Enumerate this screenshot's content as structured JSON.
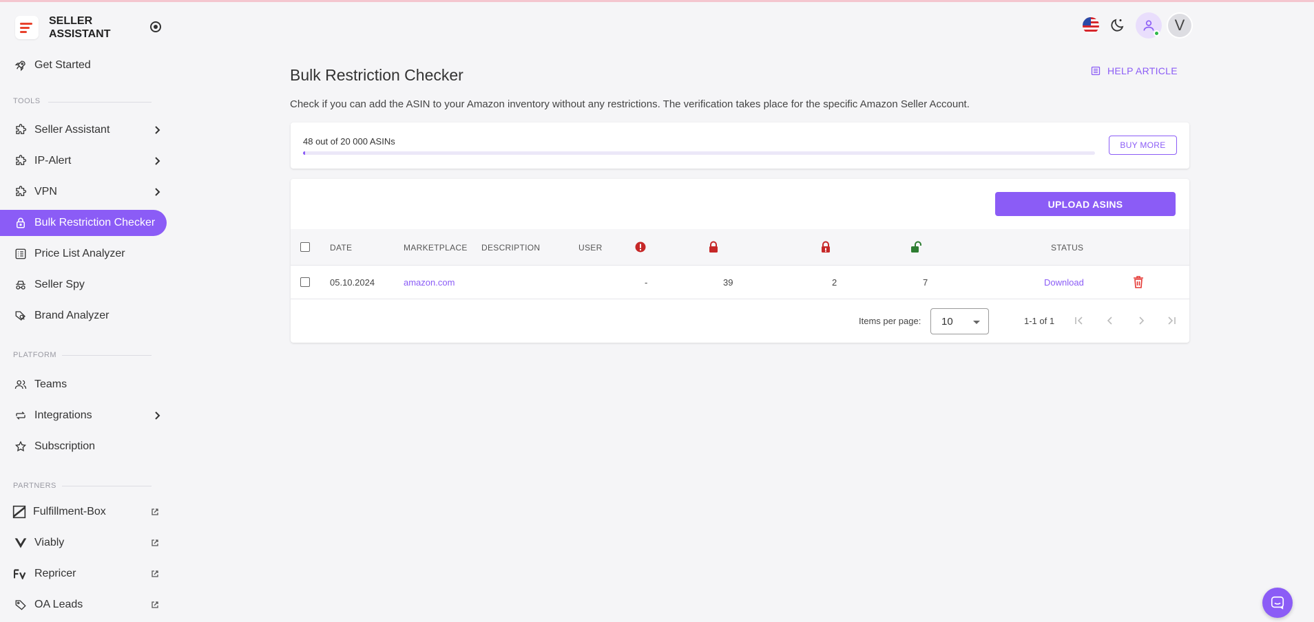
{
  "brand": {
    "name": "SELLER ASSISTANT"
  },
  "sidebar": {
    "get_started": "Get Started",
    "sections": {
      "tools": "TOOLS",
      "platform": "PLATFORM",
      "partners": "PARTNERS"
    },
    "tools": [
      {
        "label": "Seller Assistant",
        "icon": "puzzle-icon"
      },
      {
        "label": "IP-Alert",
        "icon": "puzzle-icon"
      },
      {
        "label": "VPN",
        "icon": "puzzle-icon"
      },
      {
        "label": "Bulk Restriction Checker",
        "icon": "lock-icon",
        "active": true
      },
      {
        "label": "Price List Analyzer",
        "icon": "list-icon"
      },
      {
        "label": "Seller Spy",
        "icon": "spy-icon"
      },
      {
        "label": "Brand Analyzer",
        "icon": "tag-search-icon"
      }
    ],
    "platform": [
      {
        "label": "Teams",
        "icon": "people-icon"
      },
      {
        "label": "Integrations",
        "icon": "swap-icon"
      },
      {
        "label": "Subscription",
        "icon": "star-icon"
      }
    ],
    "partners": [
      {
        "label": "Fulfillment-Box",
        "icon": "fulfillment-box-logo-icon"
      },
      {
        "label": "Viably",
        "icon": "viably-logo-icon"
      },
      {
        "label": "Repricer",
        "icon": "repricer-logo-icon"
      },
      {
        "label": "OA Leads",
        "icon": "tag-icon"
      }
    ]
  },
  "header": {
    "avatar_letter": "V"
  },
  "main": {
    "title": "Bulk Restriction Checker",
    "help_label": "HELP ARTICLE",
    "description": "Check if you can add the ASIN to your Amazon inventory without any restrictions. The verification takes place for the specific Amazon Seller Account.",
    "quota": {
      "text": "48 out of 20 000 ASINs",
      "used": 48,
      "total": 20000,
      "buy_label": "BUY MORE"
    },
    "upload_label": "UPLOAD ASINS",
    "table": {
      "headers": {
        "date": "DATE",
        "marketplace": "MARKETPLACE",
        "description": "DESCRIPTION",
        "user": "USER",
        "status": "STATUS"
      },
      "rows": [
        {
          "date": "05.10.2024",
          "marketplace": "amazon.com",
          "description": "",
          "user": "",
          "errors": "-",
          "restricted": "39",
          "approval": "2",
          "allowed": "7",
          "status": "Download"
        }
      ]
    },
    "pagination": {
      "label": "Items per page:",
      "per_page": "10",
      "range": "1-1 of 1"
    }
  },
  "colors": {
    "accent": "#8b5cf6",
    "error": "#c62828",
    "restricted": "#c62828",
    "allowed": "#2e7d32",
    "delete": "#e53935"
  }
}
